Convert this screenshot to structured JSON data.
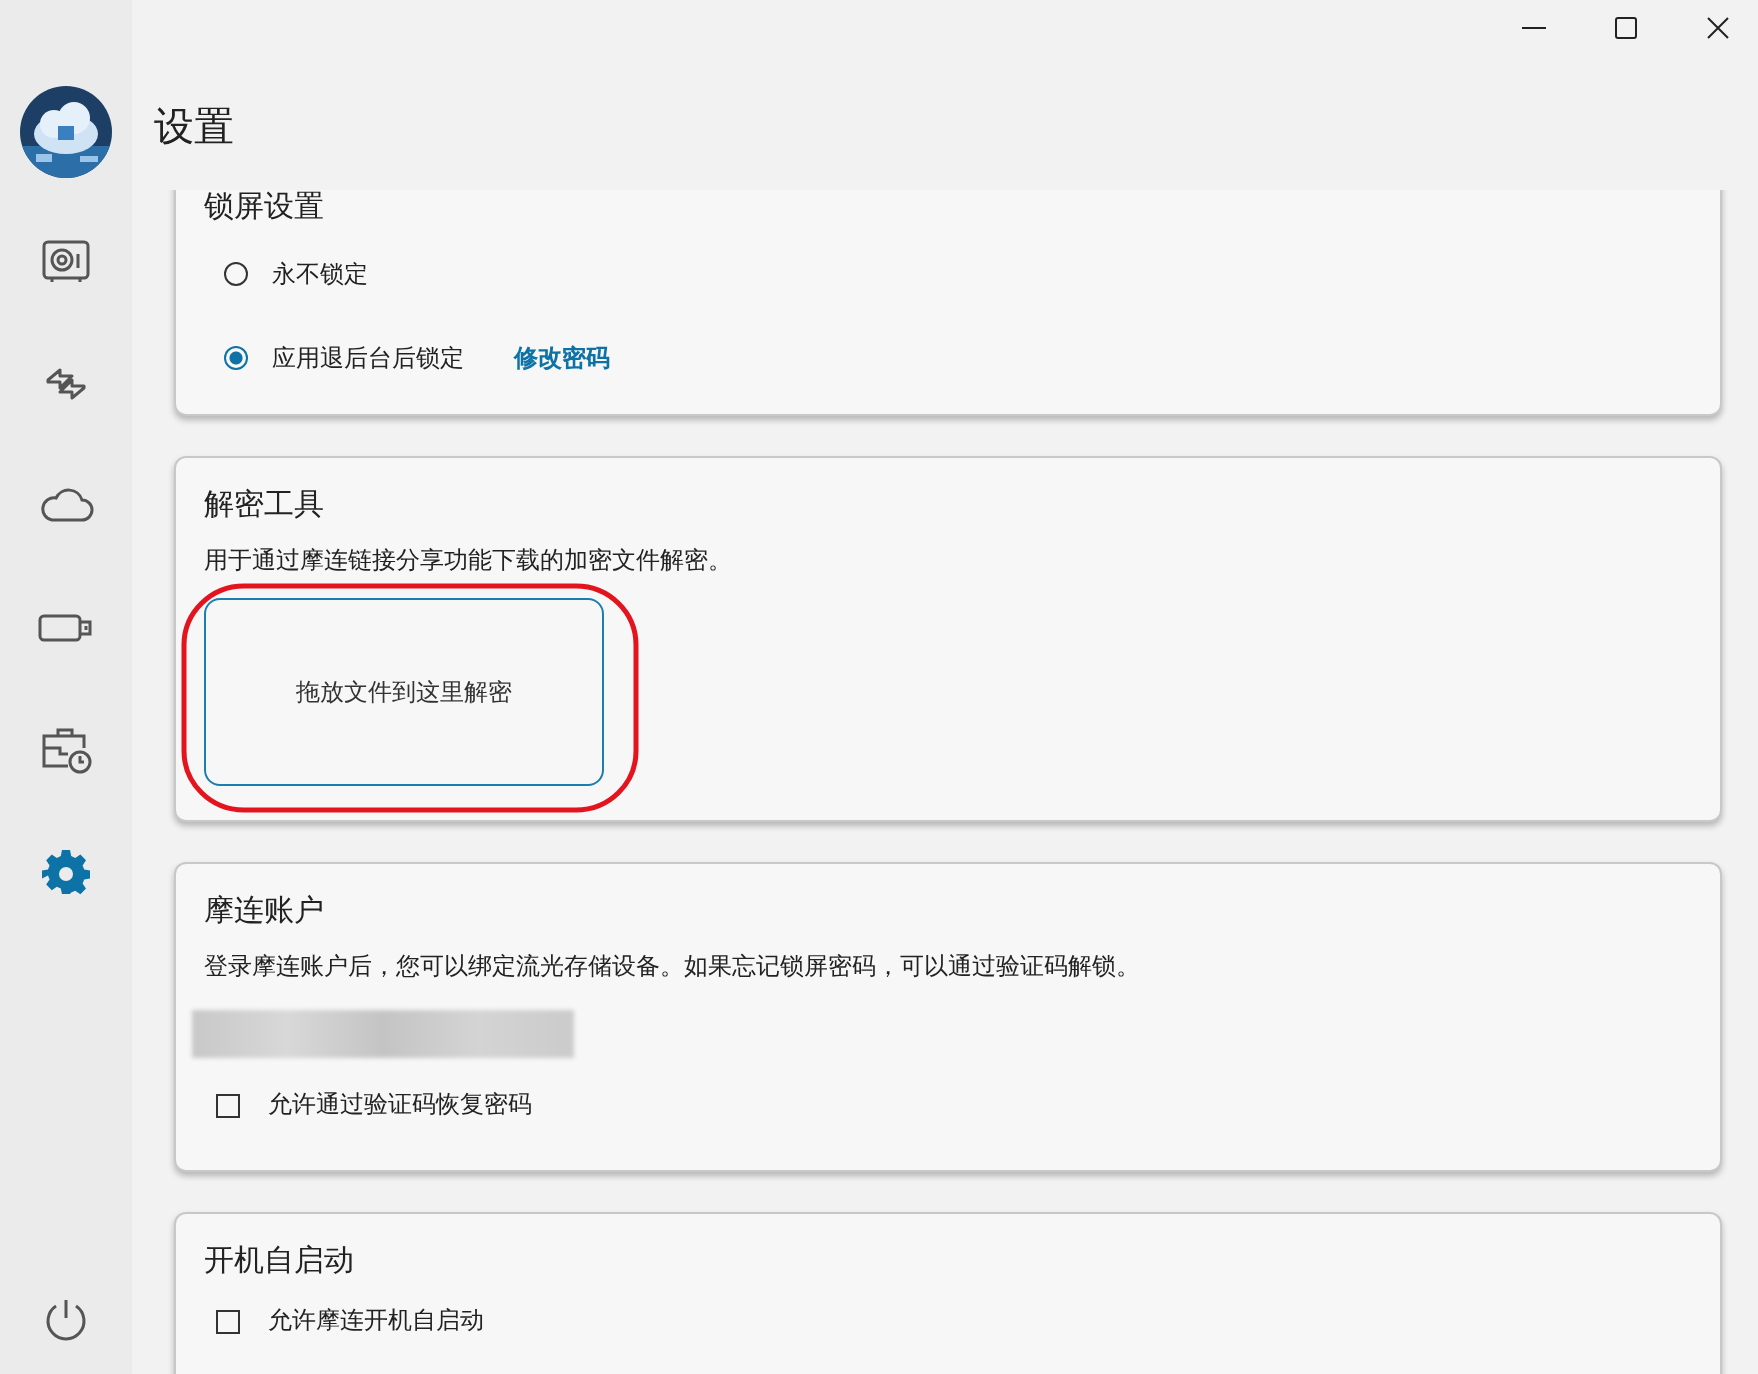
{
  "window": {
    "title": "设置"
  },
  "sidebar": {
    "items": [
      {
        "kind": "safe",
        "selected": false
      },
      {
        "kind": "transfer",
        "selected": false
      },
      {
        "kind": "cloud",
        "selected": false
      },
      {
        "kind": "drive",
        "selected": false
      },
      {
        "kind": "briefcase",
        "selected": false
      },
      {
        "kind": "settings",
        "selected": true
      }
    ]
  },
  "lock_screen": {
    "title": "锁屏设置",
    "options": [
      {
        "label": "永不锁定",
        "selected": false
      },
      {
        "label": "应用退后台后锁定",
        "selected": true
      }
    ],
    "link": "修改密码"
  },
  "decrypt_tool": {
    "title": "解密工具",
    "description": "用于通过摩连链接分享功能下载的加密文件解密。",
    "drop_zone": "拖放文件到这里解密"
  },
  "account": {
    "title": "摩连账户",
    "description": "登录摩连账户后，您可以绑定流光存储设备。如果忘记锁屏密码，可以通过验证码解锁。",
    "checkbox": {
      "label": "允许通过验证码恢复密码",
      "checked": false
    }
  },
  "autostart": {
    "title": "开机自启动",
    "checkbox": {
      "label": "允许摩连开机自启动",
      "checked": false
    }
  }
}
